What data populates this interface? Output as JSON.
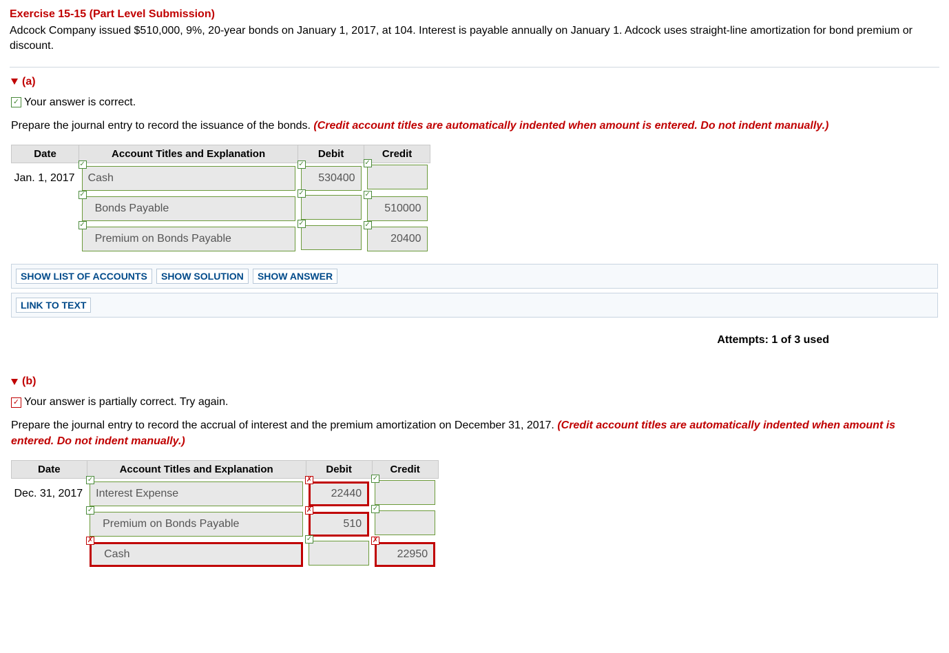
{
  "exercise_title": "Exercise 15-15 (Part Level Submission)",
  "problem": "Adcock Company issued $510,000, 9%, 20-year bonds on January 1, 2017, at 104. Interest is payable annually on January 1. Adcock uses straight-line amortization for bond premium or discount.",
  "partA": {
    "label": "(a)",
    "status_text": "Your answer is correct.",
    "instruction": "Prepare the journal entry to record the issuance of the bonds. ",
    "instruction_em": "(Credit account titles are automatically indented when amount is entered. Do not indent manually.)",
    "headers": {
      "date": "Date",
      "acct": "Account Titles and Explanation",
      "debit": "Debit",
      "credit": "Credit"
    },
    "date": "Jan. 1, 2017",
    "rows": [
      {
        "acct": "Cash",
        "debit": "530400",
        "credit": ""
      },
      {
        "acct": "Bonds Payable",
        "debit": "",
        "credit": "510000"
      },
      {
        "acct": "Premium on Bonds Payable",
        "debit": "",
        "credit": "20400"
      }
    ],
    "buttons": {
      "list": "SHOW LIST OF ACCOUNTS",
      "solution": "SHOW SOLUTION",
      "answer": "SHOW ANSWER",
      "link": "LINK TO TEXT"
    },
    "attempts": "Attempts: 1 of 3 used"
  },
  "partB": {
    "label": "(b)",
    "status_text": "Your answer is partially correct.  Try again.",
    "instruction": "Prepare the journal entry to record the accrual of interest and the premium amortization on December 31, 2017. ",
    "instruction_em": "(Credit account titles are automatically indented when amount is entered. Do not indent manually.)",
    "headers": {
      "date": "Date",
      "acct": "Account Titles and Explanation",
      "debit": "Debit",
      "credit": "Credit"
    },
    "date": "Dec. 31, 2017",
    "rows": [
      {
        "acct": "Interest Expense",
        "debit": "22440",
        "credit": ""
      },
      {
        "acct": "Premium on Bonds Payable",
        "debit": "510",
        "credit": ""
      },
      {
        "acct": "Cash",
        "debit": "",
        "credit": "22950"
      }
    ]
  }
}
